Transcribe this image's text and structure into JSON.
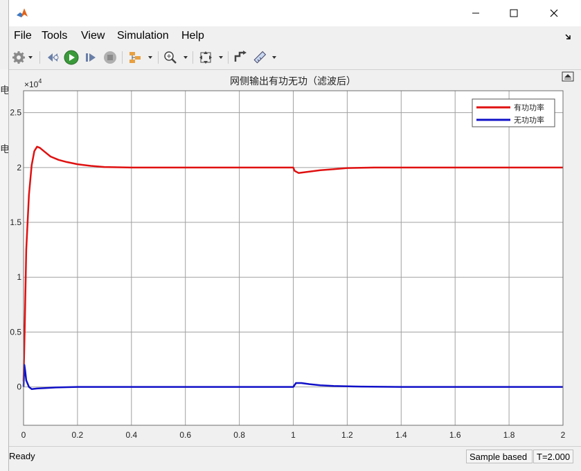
{
  "window": {
    "title": ""
  },
  "menu": [
    {
      "label": "File"
    },
    {
      "label": "Tools"
    },
    {
      "label": "View"
    },
    {
      "label": "Simulation"
    },
    {
      "label": "Help"
    }
  ],
  "toolbar": {
    "items": [
      "gear-icon",
      "step-back-icon",
      "run-icon",
      "step-forward-icon",
      "stop-icon",
      "signal-selector-icon",
      "zoom-icon",
      "autoscale-icon",
      "triggers-icon",
      "measurements-icon"
    ]
  },
  "background_labels": [
    "电",
    "电"
  ],
  "status": {
    "left": "Ready",
    "mode": "Sample based",
    "time": "T=2.000"
  },
  "colors": {
    "red_series": "#e01010",
    "blue_series": "#1010c8",
    "grid": "#a0a0a0"
  },
  "chart_data": {
    "type": "line",
    "title": "网侧输出有功无功（滤波后）",
    "y_exponent": "×10^4",
    "exponent_base": "×10",
    "exponent_power": "4",
    "xlim": [
      0,
      2
    ],
    "ylim": [
      -0.35,
      2.7
    ],
    "x_ticks": [
      0,
      0.2,
      0.4,
      0.6,
      0.8,
      1,
      1.2,
      1.4,
      1.6,
      1.8,
      2
    ],
    "x_tick_labels": [
      "0",
      "0.2",
      "0.4",
      "0.6",
      "0.8",
      "1",
      "1.2",
      "1.4",
      "1.6",
      "1.8",
      "2"
    ],
    "y_ticks": [
      0,
      0.5,
      1,
      1.5,
      2,
      2.5
    ],
    "y_tick_labels": [
      "0",
      "0.5",
      "1",
      "1.5",
      "2",
      "2.5"
    ],
    "grid": true,
    "legend_position": "top-right",
    "series": [
      {
        "name": "有功功率",
        "color": "#e01010",
        "x": [
          0,
          0.005,
          0.01,
          0.02,
          0.03,
          0.04,
          0.05,
          0.06,
          0.08,
          0.1,
          0.13,
          0.16,
          0.2,
          0.25,
          0.3,
          0.4,
          0.5,
          1.0,
          1.005,
          1.02,
          1.05,
          1.1,
          1.15,
          1.2,
          1.3,
          1.5,
          2.0
        ],
        "y": [
          0.05,
          0.6,
          1.25,
          1.75,
          2.02,
          2.15,
          2.19,
          2.18,
          2.14,
          2.1,
          2.07,
          2.05,
          2.03,
          2.015,
          2.005,
          2.0,
          2.0,
          2.0,
          1.97,
          1.95,
          1.96,
          1.975,
          1.985,
          1.995,
          2.0,
          2.0,
          2.0
        ]
      },
      {
        "name": "无功功率",
        "color": "#1010c8",
        "x": [
          0,
          0.003,
          0.006,
          0.01,
          0.02,
          0.03,
          0.05,
          0.08,
          0.12,
          0.2,
          0.3,
          0.5,
          1.0,
          1.01,
          1.03,
          1.06,
          1.1,
          1.15,
          1.25,
          1.4,
          2.0
        ],
        "y": [
          0.0,
          0.2,
          0.15,
          0.06,
          0.0,
          -0.02,
          -0.015,
          -0.01,
          -0.005,
          0.0,
          0.0,
          0.0,
          0.0,
          0.035,
          0.035,
          0.025,
          0.015,
          0.008,
          0.003,
          0.0,
          0.0
        ]
      }
    ]
  }
}
